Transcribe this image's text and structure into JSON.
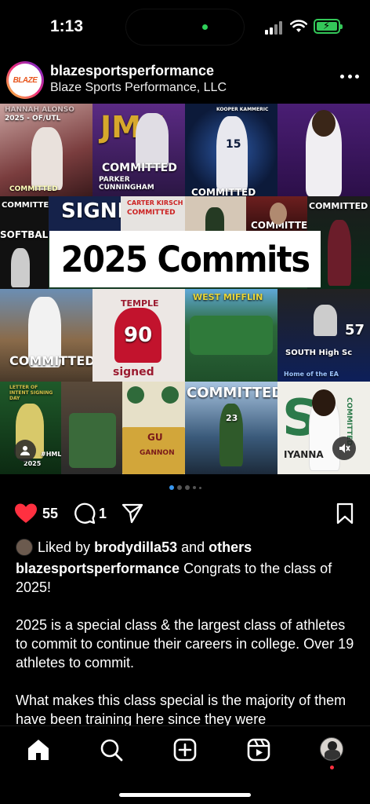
{
  "status_bar": {
    "time": "1:13"
  },
  "post": {
    "username": "blazesportsperformance",
    "display_name": "Blaze Sports Performance, LLC",
    "avatar_logo_text": "BLAZE",
    "collage": {
      "headline": "2025 Commits",
      "tiles": {
        "t1_name": "HANNAH ALONSO",
        "t1_sub": "2025 - OF/UTL",
        "t1_committed": "COMMITTED",
        "t2_school": "JMU",
        "t2_committed": "COMMITTED",
        "t2_name": "PARKER CUNNINGHAM",
        "t3_name": "KOOPER KAMMERIC",
        "t3_number": "15",
        "t3_committed": "COMMITTED",
        "t5_committed": "COMMITTED",
        "t5_softball": "SOFTBALL",
        "t6_signed": "SIGNED",
        "t7_name": "CARTER KIRSCH",
        "t7_committed": "COMMITTED",
        "t9_committed": "COMMITTED",
        "t11_committed": "COMMITTED",
        "t12_school": "TEMPLE",
        "t12_number": "90",
        "t12_signed": "signed",
        "t13_school": "WEST MIFFLIN",
        "t14_school": "SOUTH High Sc",
        "t14_number": "57",
        "t14_home": "Home of the EA",
        "t15_letter": "LETTER OF INTENT SIGNING DAY",
        "t15_year": "2025",
        "t15_tag": "#HML",
        "t16_school": "GU",
        "t16_name": "GANNON",
        "t17_committed": "COMMITTED",
        "t17_number": "23",
        "t18_name": "IYANNA",
        "t18_committed": "COMMITTED"
      }
    },
    "carousel_dots": 5,
    "carousel_active": 1,
    "likes_count": "55",
    "comments_count": "1",
    "liked_by_prefix": "Liked by",
    "liked_by_user": "brodydilla53",
    "liked_by_and": "and",
    "liked_by_others": "others",
    "caption_username": "blazesportsperformance",
    "caption_line1": "Congrats to the class of 2025!",
    "caption_p2": "2025 is a special class & the largest class of athletes to commit to continue their careers in college. Over 19 athletes to commit.",
    "caption_p3": "What makes this class special is the majority of them have been training here since they were"
  },
  "colors": {
    "like_red": "#ff3040",
    "accent_blue": "#3897f0",
    "battery_green": "#34c759"
  },
  "icons": {
    "like": "heart-filled-icon",
    "comment": "comment-icon",
    "share": "send-icon",
    "save": "bookmark-icon",
    "more": "more-horizontal-icon",
    "mute": "speaker-muted-icon",
    "tag": "person-tag-icon"
  },
  "tab_bar": {
    "items": [
      "home",
      "search",
      "create",
      "reels",
      "profile"
    ]
  }
}
